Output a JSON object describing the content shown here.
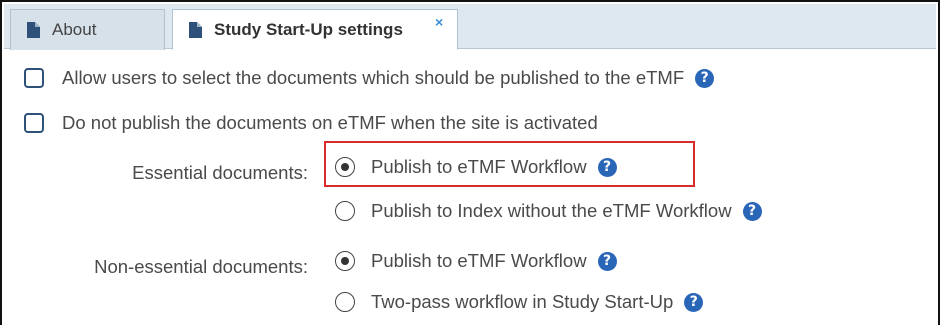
{
  "tabs": {
    "about": {
      "label": "About",
      "icon": "document-icon"
    },
    "settings": {
      "label": "Study Start-Up settings",
      "icon": "document-icon",
      "close_glyph": "×"
    }
  },
  "options": {
    "allow_select": {
      "label": "Allow users to select the documents which should be published to the eTMF",
      "checked": false
    },
    "do_not_publish": {
      "label": "Do not publish the documents on eTMF when the site is activated",
      "checked": false
    }
  },
  "essential": {
    "label": "Essential documents:",
    "choices": [
      {
        "label": "Publish to eTMF Workflow",
        "selected": true
      },
      {
        "label": "Publish to Index without the eTMF Workflow",
        "selected": false
      }
    ]
  },
  "non_essential": {
    "label": "Non-essential documents:",
    "choices": [
      {
        "label": "Publish to eTMF Workflow",
        "selected": true
      },
      {
        "label": "Two-pass workflow in Study Start-Up",
        "selected": false
      }
    ]
  },
  "help_glyph": "?",
  "colors": {
    "tab_bar": "#dde8f1",
    "help_icon": "#2a66b8",
    "highlight": "#d92b2b",
    "checkbox_border": "#2d5178"
  }
}
